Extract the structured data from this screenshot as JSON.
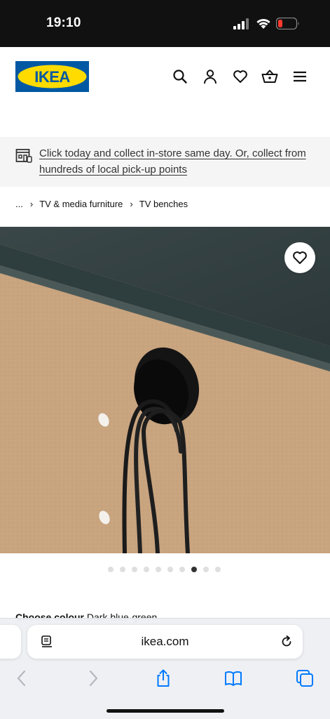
{
  "status_bar": {
    "time": "19:10",
    "signal_icon": "cellular-signal-icon",
    "wifi_icon": "wifi-icon",
    "battery_icon": "battery-low-icon",
    "battery_color": "#ff3b30"
  },
  "header": {
    "logo_text": "IKEA",
    "logo_colors": {
      "blue": "#0058a3",
      "yellow": "#ffdb00"
    },
    "icons": [
      "search-icon",
      "account-icon",
      "heart-icon",
      "basket-icon",
      "menu-icon"
    ]
  },
  "banner": {
    "icon": "store-icon",
    "text": "Click today and collect in-store same day. Or, collect from hundreds of local pick-up points"
  },
  "breadcrumb": {
    "items": [
      "...",
      "TV & media furniture",
      "TV benches"
    ]
  },
  "product": {
    "favourite_icon": "heart-icon",
    "carousel": {
      "total": 10,
      "active_index": 7
    }
  },
  "colour": {
    "label": "Choose colour",
    "value": "Dark blue-green"
  },
  "safari": {
    "url": "ikea.com",
    "reader_icon": "page-menu-icon",
    "reload_icon": "reload-icon",
    "nav_icons": [
      "back-icon",
      "forward-icon",
      "share-icon",
      "bookmarks-icon",
      "tabs-icon"
    ],
    "accent": "#007aff"
  }
}
